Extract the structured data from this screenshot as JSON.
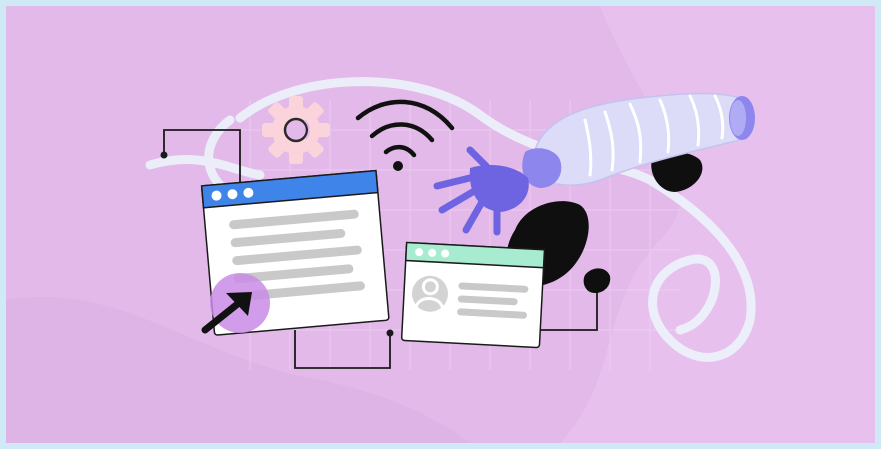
{
  "illustration": {
    "icons": [
      "gear-icon",
      "wifi-icon",
      "cursor-arrow-icon",
      "user-avatar-icon",
      "robot-arm-icon"
    ],
    "colors": {
      "background": "#e2b9e9",
      "browser_bar_blue": "#3f84e8",
      "profile_bar_green": "#a7ecd0",
      "robot_hand": "#6e63e0",
      "robot_arm": "#dcdcf8",
      "gear": "#fbd3da",
      "cursor_highlight": "#c98ce6",
      "scribble": "#ecf3fb",
      "ink": "#111111"
    }
  }
}
